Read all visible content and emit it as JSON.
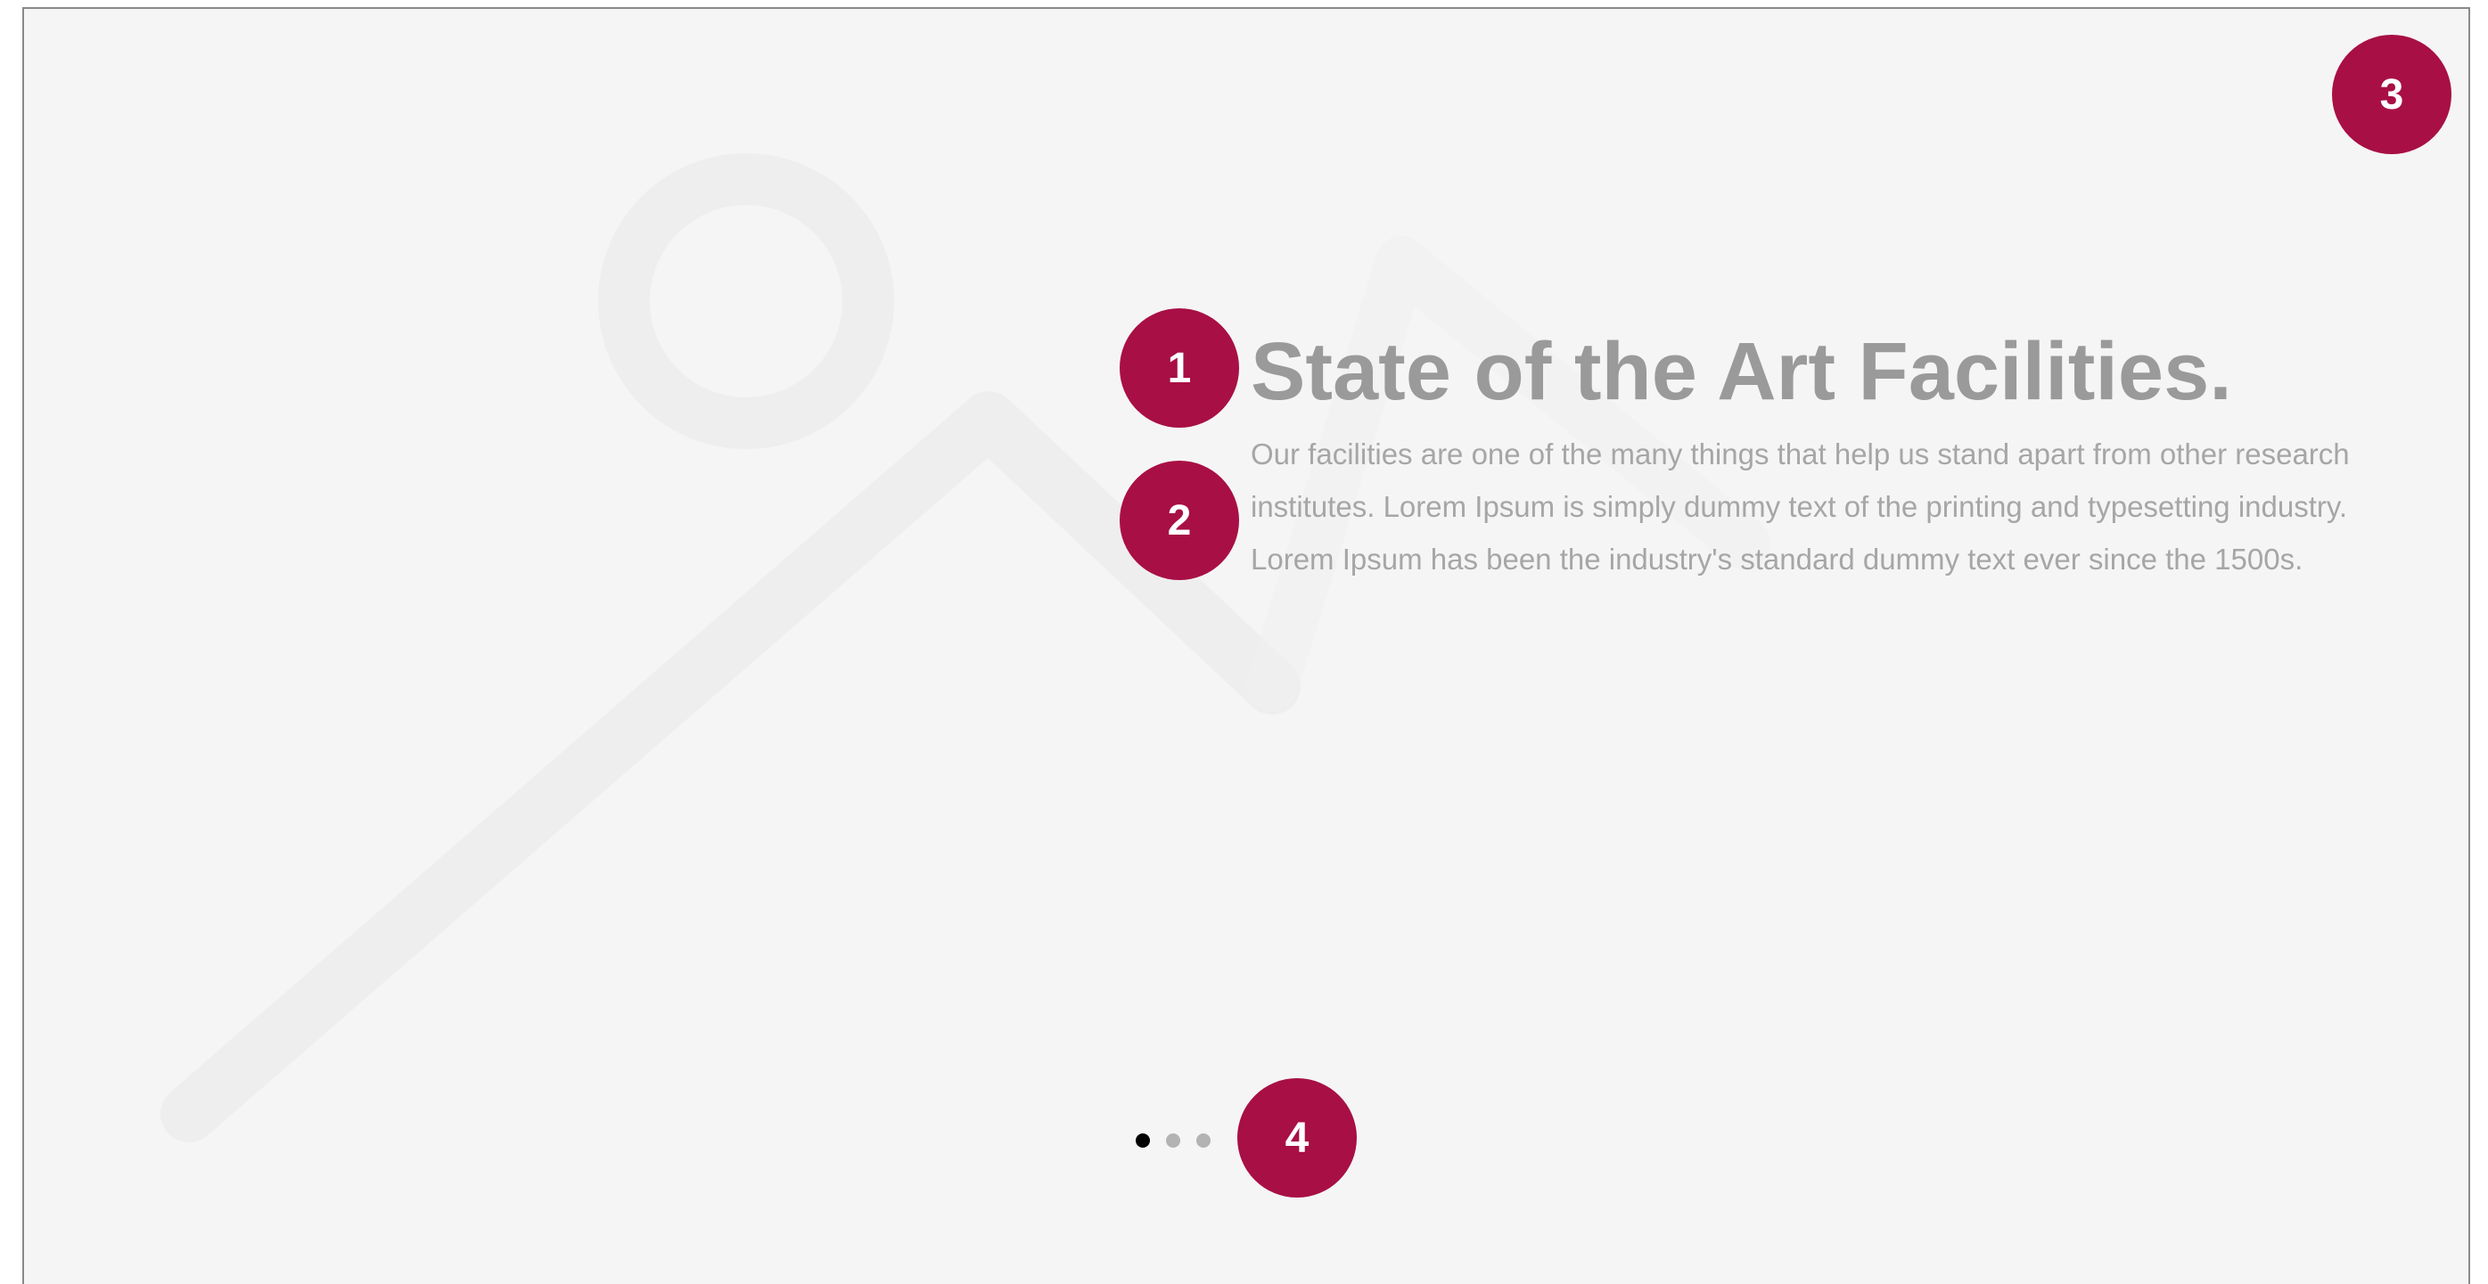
{
  "slide": {
    "title": "State of the Art Facilities.",
    "description": "Our facilities are one of the many things that help us stand apart from other research institutes. Lorem Ipsum is simply dummy text of the printing and typesetting industry. Lorem Ipsum has been the industry's standard dummy text ever since the 1500s."
  },
  "background_icon": "image-placeholder-icon",
  "pagination": {
    "count": 3,
    "active_index": 0
  },
  "markers": [
    {
      "label": "1"
    },
    {
      "label": "2"
    },
    {
      "label": "3"
    },
    {
      "label": "4"
    }
  ],
  "colors": {
    "marker": "#a80f45",
    "background": "#f5f5f5",
    "title": "#9a9a9a",
    "body": "#a6a6a6",
    "dot_active": "#000000",
    "dot_inactive": "#b3b3b3"
  }
}
